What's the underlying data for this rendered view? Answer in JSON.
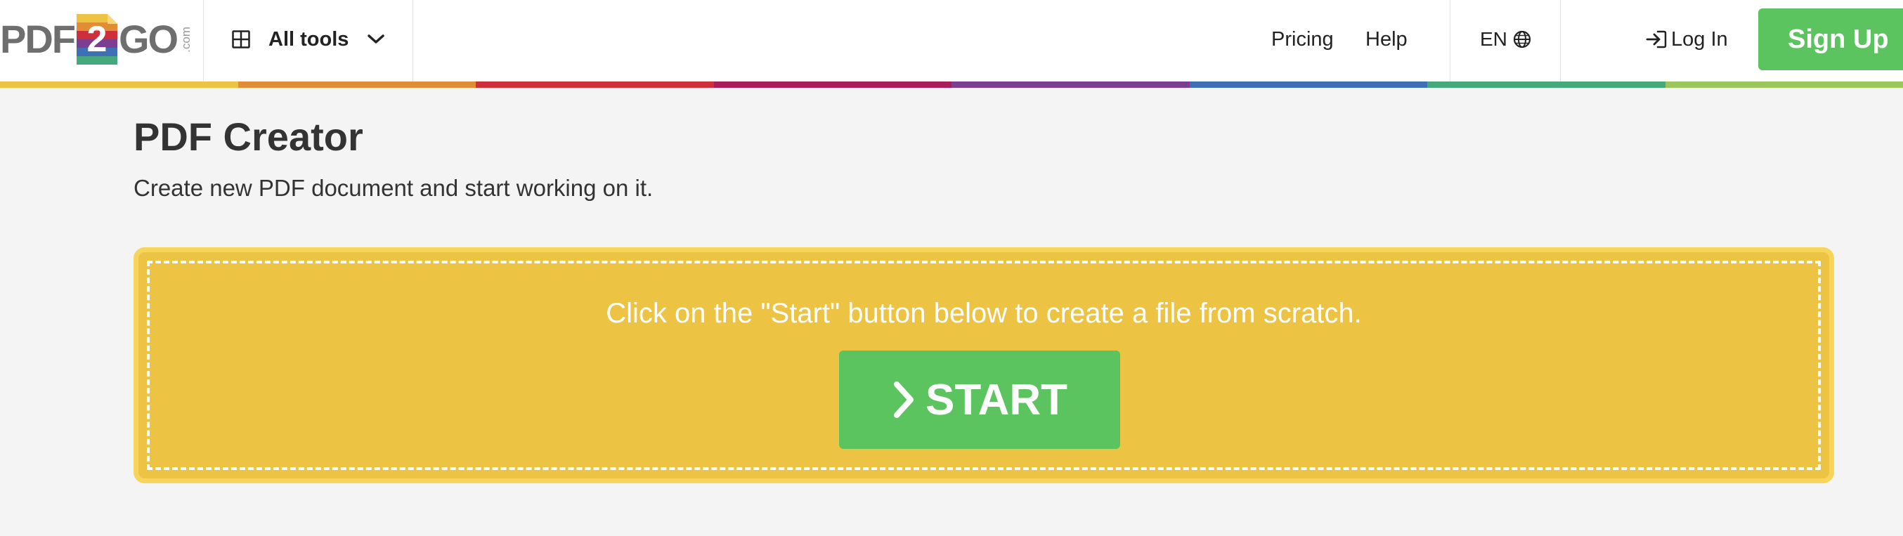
{
  "header": {
    "logo": {
      "part1": "PDF",
      "part2": "2",
      "part3": "GO",
      "suffix": ".com"
    },
    "all_tools": {
      "grid_icon": "grid-icon",
      "label": "All tools",
      "chevron_icon": "chevron-down-icon"
    },
    "nav": {
      "pricing": "Pricing",
      "help": "Help"
    },
    "language": {
      "code": "EN",
      "icon": "globe-icon"
    },
    "login": {
      "icon": "login-arrow-icon",
      "label": "Log In"
    },
    "signup": {
      "label": "Sign Up"
    },
    "rainbow_colors": [
      "#ecc343",
      "#e08d35",
      "#cf2f3a",
      "#a81d5a",
      "#7c3e91",
      "#3f6fb5",
      "#46a97d",
      "#9ac65b"
    ]
  },
  "main": {
    "title": "PDF Creator",
    "subtitle": "Create new PDF document and start working on it.",
    "dropzone": {
      "instruction": "Click on the \"Start\" button below to create a file from scratch.",
      "start_button": {
        "icon": "chevron-right-icon",
        "label": "START"
      }
    }
  },
  "colors": {
    "accent_green": "#5bc45e",
    "dropzone_yellow": "#ecc343",
    "background": "#f4f4f4"
  }
}
